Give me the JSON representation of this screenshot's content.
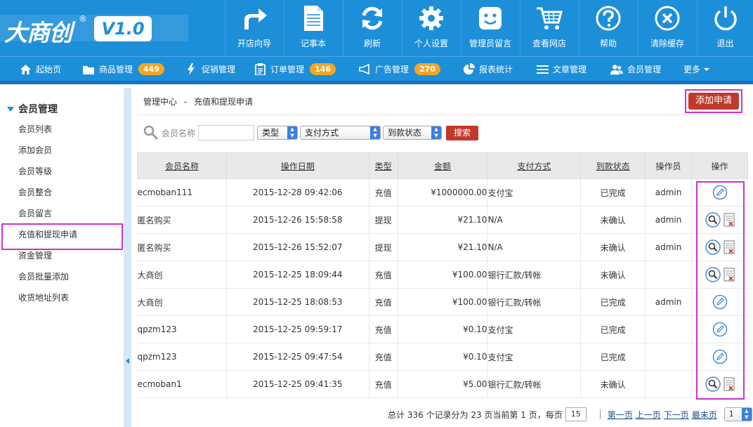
{
  "brand": {
    "logo_text": "大商创",
    "reg_mark": "®",
    "version": "V1.0"
  },
  "toolbar": [
    {
      "label": "开店向导",
      "icon": "share-arrow-icon"
    },
    {
      "label": "记事本",
      "icon": "notepad-icon"
    },
    {
      "label": "刷新",
      "icon": "refresh-icon"
    },
    {
      "label": "个人设置",
      "icon": "gear-icon"
    },
    {
      "label": "管理员留言",
      "icon": "smile-message-icon"
    },
    {
      "label": "查看网店",
      "icon": "cart-icon"
    },
    {
      "label": "帮助",
      "icon": "help-icon"
    },
    {
      "label": "清除缓存",
      "icon": "clear-cache-icon"
    },
    {
      "label": "退出",
      "icon": "power-icon"
    }
  ],
  "nav": [
    {
      "label": "起始页",
      "icon": "home-icon"
    },
    {
      "label": "商品管理",
      "icon": "folder-icon",
      "badge": "449"
    },
    {
      "label": "促销管理",
      "icon": "lightning-icon"
    },
    {
      "label": "订单管理",
      "icon": "clipboard-icon",
      "badge": "146"
    },
    {
      "label": "广告管理",
      "icon": "megaphone-icon",
      "badge": "270"
    },
    {
      "label": "报表统计",
      "icon": "pie-chart-icon"
    },
    {
      "label": "文章管理",
      "icon": "list-icon"
    },
    {
      "label": "会员管理",
      "icon": "users-icon"
    },
    {
      "label": "更多",
      "icon": "caret-down-icon"
    }
  ],
  "sidebar": {
    "group_title": "会员管理",
    "items": [
      {
        "label": "会员列表"
      },
      {
        "label": "添加会员"
      },
      {
        "label": "会员等级"
      },
      {
        "label": "会员整合"
      },
      {
        "label": "会员留言"
      },
      {
        "label": "充值和提现申请",
        "active": true
      },
      {
        "label": "资金管理"
      },
      {
        "label": "会员批量添加"
      },
      {
        "label": "收货地址列表"
      }
    ]
  },
  "breadcrumb": {
    "root": "管理中心",
    "sep": "-",
    "current": "充值和提现申请"
  },
  "add_button_label": "添加申请",
  "filter": {
    "member_label": "会员名称",
    "member_value": "",
    "type_select": "类型",
    "pay_select": "支付方式",
    "status_select": "到款状态",
    "search_button": "搜索"
  },
  "table": {
    "headers": [
      "会员名称",
      "操作日期",
      "类型",
      "金额",
      "支付方式",
      "到款状态",
      "操作员",
      "操作"
    ],
    "rows": [
      {
        "name": "ecmoban111",
        "date": "2015-12-28 09:42:06",
        "type": "充值",
        "amount": "¥1000000.00",
        "pay": "支付宝",
        "status": "已完成",
        "operator": "admin",
        "ops": [
          "edit"
        ]
      },
      {
        "name": "匿名购买",
        "date": "2015-12-26 15:58:58",
        "type": "提现",
        "amount": "¥21.10",
        "pay": "N/A",
        "status": "未确认",
        "operator": "admin",
        "ops": [
          "view",
          "delete"
        ]
      },
      {
        "name": "匿名购买",
        "date": "2015-12-26 15:52:07",
        "type": "提现",
        "amount": "¥21.10",
        "pay": "N/A",
        "status": "未确认",
        "operator": "admin",
        "ops": [
          "view",
          "delete"
        ]
      },
      {
        "name": "大商创",
        "date": "2015-12-25 18:09:44",
        "type": "充值",
        "amount": "¥100.00",
        "pay": "银行汇款/转帐",
        "status": "未确认",
        "operator": "",
        "ops": [
          "view",
          "delete"
        ]
      },
      {
        "name": "大商创",
        "date": "2015-12-25 18:08:53",
        "type": "充值",
        "amount": "¥100.00",
        "pay": "银行汇款/转帐",
        "status": "已完成",
        "operator": "admin",
        "ops": [
          "edit"
        ]
      },
      {
        "name": "qpzm123",
        "date": "2015-12-25 09:59:17",
        "type": "充值",
        "amount": "¥0.10",
        "pay": "支付宝",
        "status": "已完成",
        "operator": "",
        "ops": [
          "edit"
        ]
      },
      {
        "name": "qpzm123",
        "date": "2015-12-25 09:47:54",
        "type": "充值",
        "amount": "¥0.10",
        "pay": "支付宝",
        "status": "已完成",
        "operator": "",
        "ops": [
          "edit"
        ]
      },
      {
        "name": "ecmoban1",
        "date": "2015-12-25 09:41:35",
        "type": "充值",
        "amount": "¥5.00",
        "pay": "银行汇款/转帐",
        "status": "未确认",
        "operator": "",
        "ops": [
          "view",
          "delete"
        ]
      }
    ]
  },
  "pager": {
    "summary": "总计 336 个记录分为 23 页当前第 1 页，每页",
    "per_page": "15",
    "first": "第一页",
    "prev": "上一页",
    "next": "下一页",
    "last": "最末页",
    "page_select": "1"
  },
  "colors": {
    "primary": "#1d8fd9",
    "danger": "#c0392b",
    "badge": "#f5a623",
    "highlight": "#cc33cc"
  }
}
